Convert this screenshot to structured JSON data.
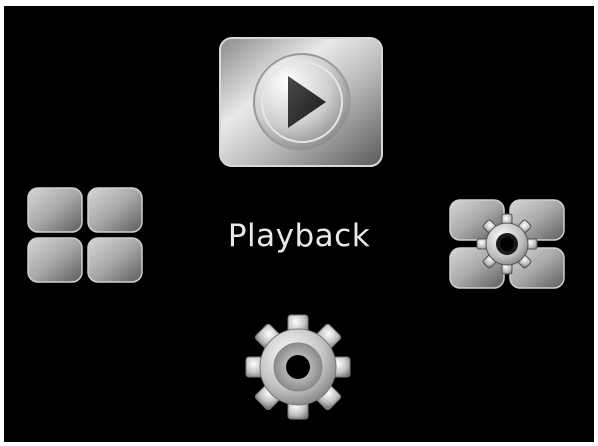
{
  "menu": {
    "selected_label": "Playback",
    "items": [
      {
        "icon": "play-icon"
      },
      {
        "icon": "grid-icon"
      },
      {
        "icon": "gear-grid-icon"
      },
      {
        "icon": "gear-icon"
      }
    ]
  },
  "colors": {
    "background": "#000000",
    "label": "#e8e8e8",
    "metal_light": "#f2f2f2",
    "metal_dark": "#6e6e6e"
  }
}
